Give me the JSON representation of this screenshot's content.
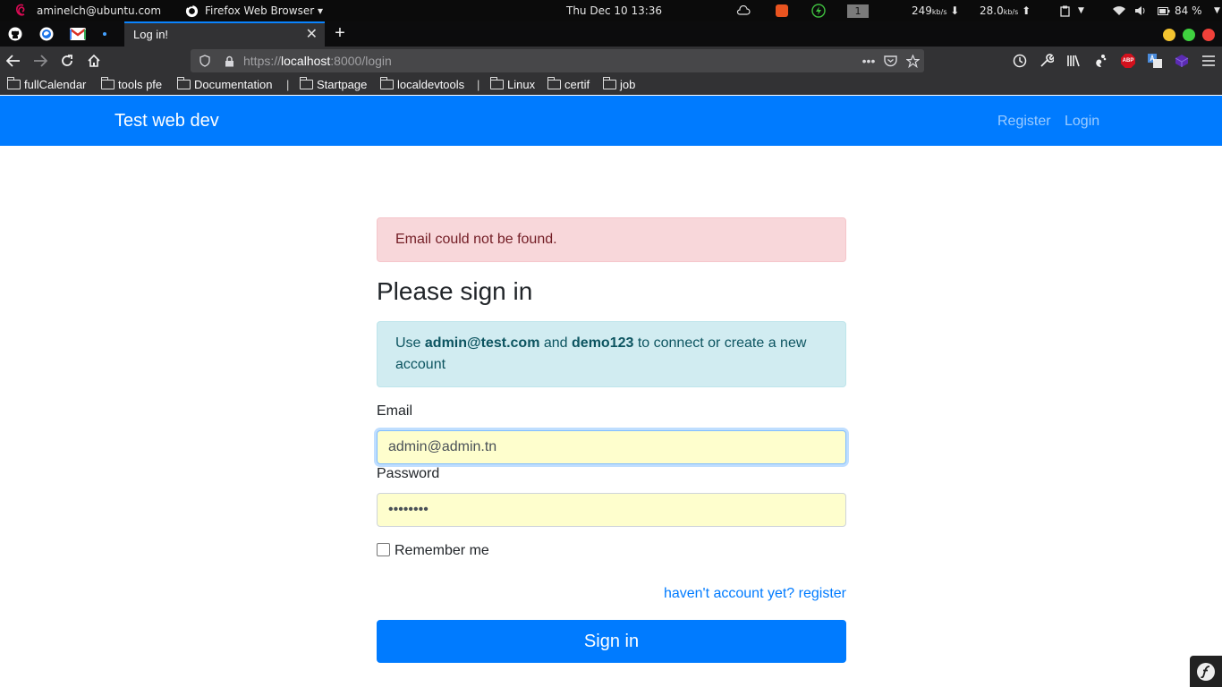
{
  "topbar": {
    "user": "aminelch@ubuntu.com",
    "app_menu": "Firefox Web Browser ▾",
    "clock": "Thu Dec 10  13:36",
    "workspace": "1",
    "down_speed": "249",
    "down_unit": "kb/s",
    "up_speed": "28.0",
    "up_unit": "kb/s",
    "battery": "84 %"
  },
  "browser": {
    "tab_title": "Log in!",
    "url_scheme": "https://",
    "url_host": "localhost",
    "url_rest": ":8000/login",
    "bookmarks": [
      "fullCalendar",
      "tools pfe",
      "Documentation",
      "Startpage",
      "localdevtools",
      "Linux",
      "certif",
      "job"
    ],
    "abp_label": "ABP"
  },
  "site": {
    "brand": "Test web dev",
    "nav_register": "Register",
    "nav_login": "Login"
  },
  "login": {
    "error": "Email could not be found.",
    "title": "Please sign in",
    "info_prefix": "Use ",
    "info_email": "admin@test.com",
    "info_and": " and ",
    "info_password": "demo123",
    "info_suffix": " to connect or create a new account",
    "email_label": "Email",
    "email_value": "admin@admin.tn",
    "password_label": "Password",
    "password_value": "••••••••",
    "remember_label": "Remember me",
    "register_link": "haven't account yet? register",
    "submit": "Sign in"
  },
  "colors": {
    "primary": "#007bff",
    "danger_bg": "#f8d7da",
    "info_bg": "#d1ecf1",
    "autofill_bg": "#fefecd"
  }
}
